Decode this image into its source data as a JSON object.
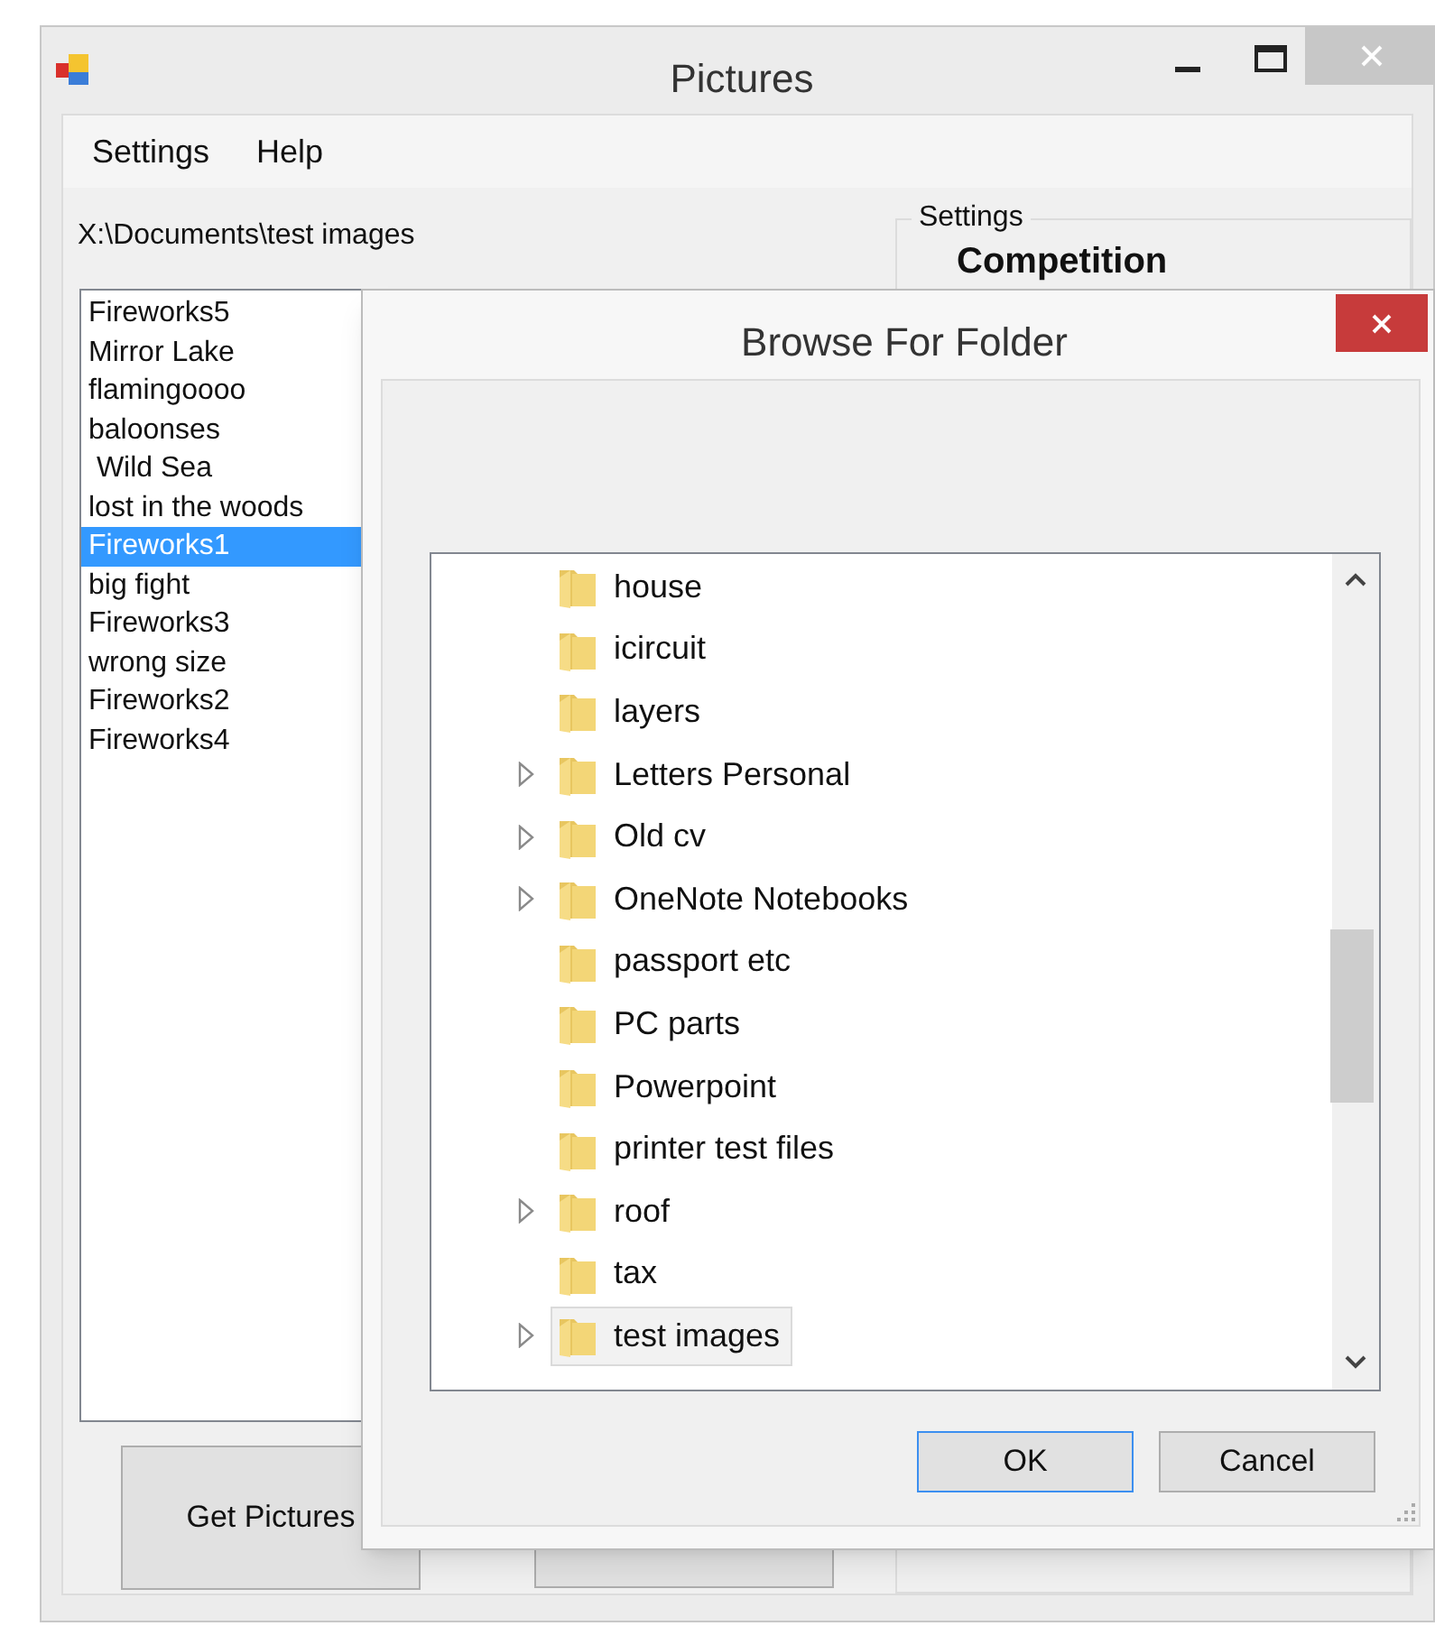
{
  "window": {
    "title": "Pictures"
  },
  "menu": [
    "Settings",
    "Help"
  ],
  "path": "X:\\Documents\\test images",
  "pictures": [
    {
      "name": "Fireworks5",
      "selected": false
    },
    {
      "name": "Mirror Lake",
      "selected": false
    },
    {
      "name": "flamingoooo",
      "selected": false
    },
    {
      "name": "baloonses",
      "selected": false
    },
    {
      "name": " Wild Sea",
      "selected": false
    },
    {
      "name": "lost in the woods",
      "selected": false
    },
    {
      "name": "Fireworks1",
      "selected": true
    },
    {
      "name": "big fight",
      "selected": false
    },
    {
      "name": "Fireworks3",
      "selected": false
    },
    {
      "name": "wrong size",
      "selected": false
    },
    {
      "name": "Fireworks2",
      "selected": false
    },
    {
      "name": "Fireworks4",
      "selected": false
    }
  ],
  "buttons": [
    "Get Pictures"
  ],
  "settings_group": {
    "title": "Settings",
    "heading": "Competition"
  },
  "dialog": {
    "title": "Browse For Folder",
    "folders": [
      {
        "name": "house",
        "expandable": false,
        "selected": false
      },
      {
        "name": "icircuit",
        "expandable": false,
        "selected": false
      },
      {
        "name": "layers",
        "expandable": false,
        "selected": false
      },
      {
        "name": "Letters Personal",
        "expandable": true,
        "selected": false
      },
      {
        "name": "Old cv",
        "expandable": true,
        "selected": false
      },
      {
        "name": "OneNote Notebooks",
        "expandable": true,
        "selected": false
      },
      {
        "name": "passport etc",
        "expandable": false,
        "selected": false
      },
      {
        "name": "PC parts",
        "expandable": false,
        "selected": false
      },
      {
        "name": "Powerpoint",
        "expandable": false,
        "selected": false
      },
      {
        "name": "printer test files",
        "expandable": false,
        "selected": false
      },
      {
        "name": "roof",
        "expandable": true,
        "selected": false
      },
      {
        "name": "tax",
        "expandable": false,
        "selected": false
      },
      {
        "name": "test images",
        "expandable": true,
        "selected": true
      }
    ],
    "buttons": [
      {
        "label": "OK",
        "default": true
      },
      {
        "label": "Cancel",
        "default": false
      }
    ]
  }
}
